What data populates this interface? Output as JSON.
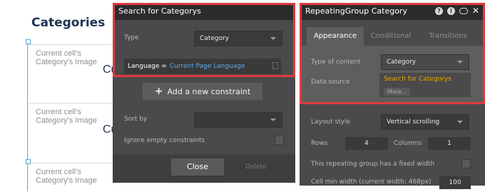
{
  "canvas": {
    "title": "Categories",
    "cells": [
      {
        "text": "Current cell's Category's Image",
        "big": "Cu"
      },
      {
        "text": "Current cell's Category's Image",
        "big": "Cu"
      },
      {
        "text": "Current cell's Category's Image",
        "big": ""
      }
    ]
  },
  "search_panel": {
    "title": "Search for Categorys",
    "type_label": "Type",
    "type_value": "Category",
    "constraint": {
      "key": "Language =",
      "value": "Current Page Language"
    },
    "add_constraint": "Add a new constraint",
    "sort_by_label": "Sort by",
    "ignore_empty_label": "Ignore empty constraints",
    "close": "Close",
    "delete": "Delete"
  },
  "rg_panel": {
    "title": "RepeatingGroup Category",
    "tabs": [
      "Appearance",
      "Conditional",
      "Transitions"
    ],
    "type_of_content_label": "Type of content",
    "type_of_content_value": "Category",
    "data_source_label": "Data source",
    "data_source_value": "Search for Categorys",
    "more": "More...",
    "layout_style_label": "Layout style",
    "layout_style_value": "Vertical scrolling",
    "rows_label": "Rows",
    "rows_value": "4",
    "columns_label": "Columns",
    "columns_value": "1",
    "fixed_width_label": "This repeating group has a fixed width",
    "min_width_label": "Cell min width (current width: 468px)",
    "min_width_value": "100"
  },
  "icons": {
    "help": "?",
    "info": "i",
    "close": "✕"
  },
  "colors": {
    "highlight": "#e0393e",
    "link_blue": "#5fa8e8",
    "link_orange": "#e6a700"
  }
}
